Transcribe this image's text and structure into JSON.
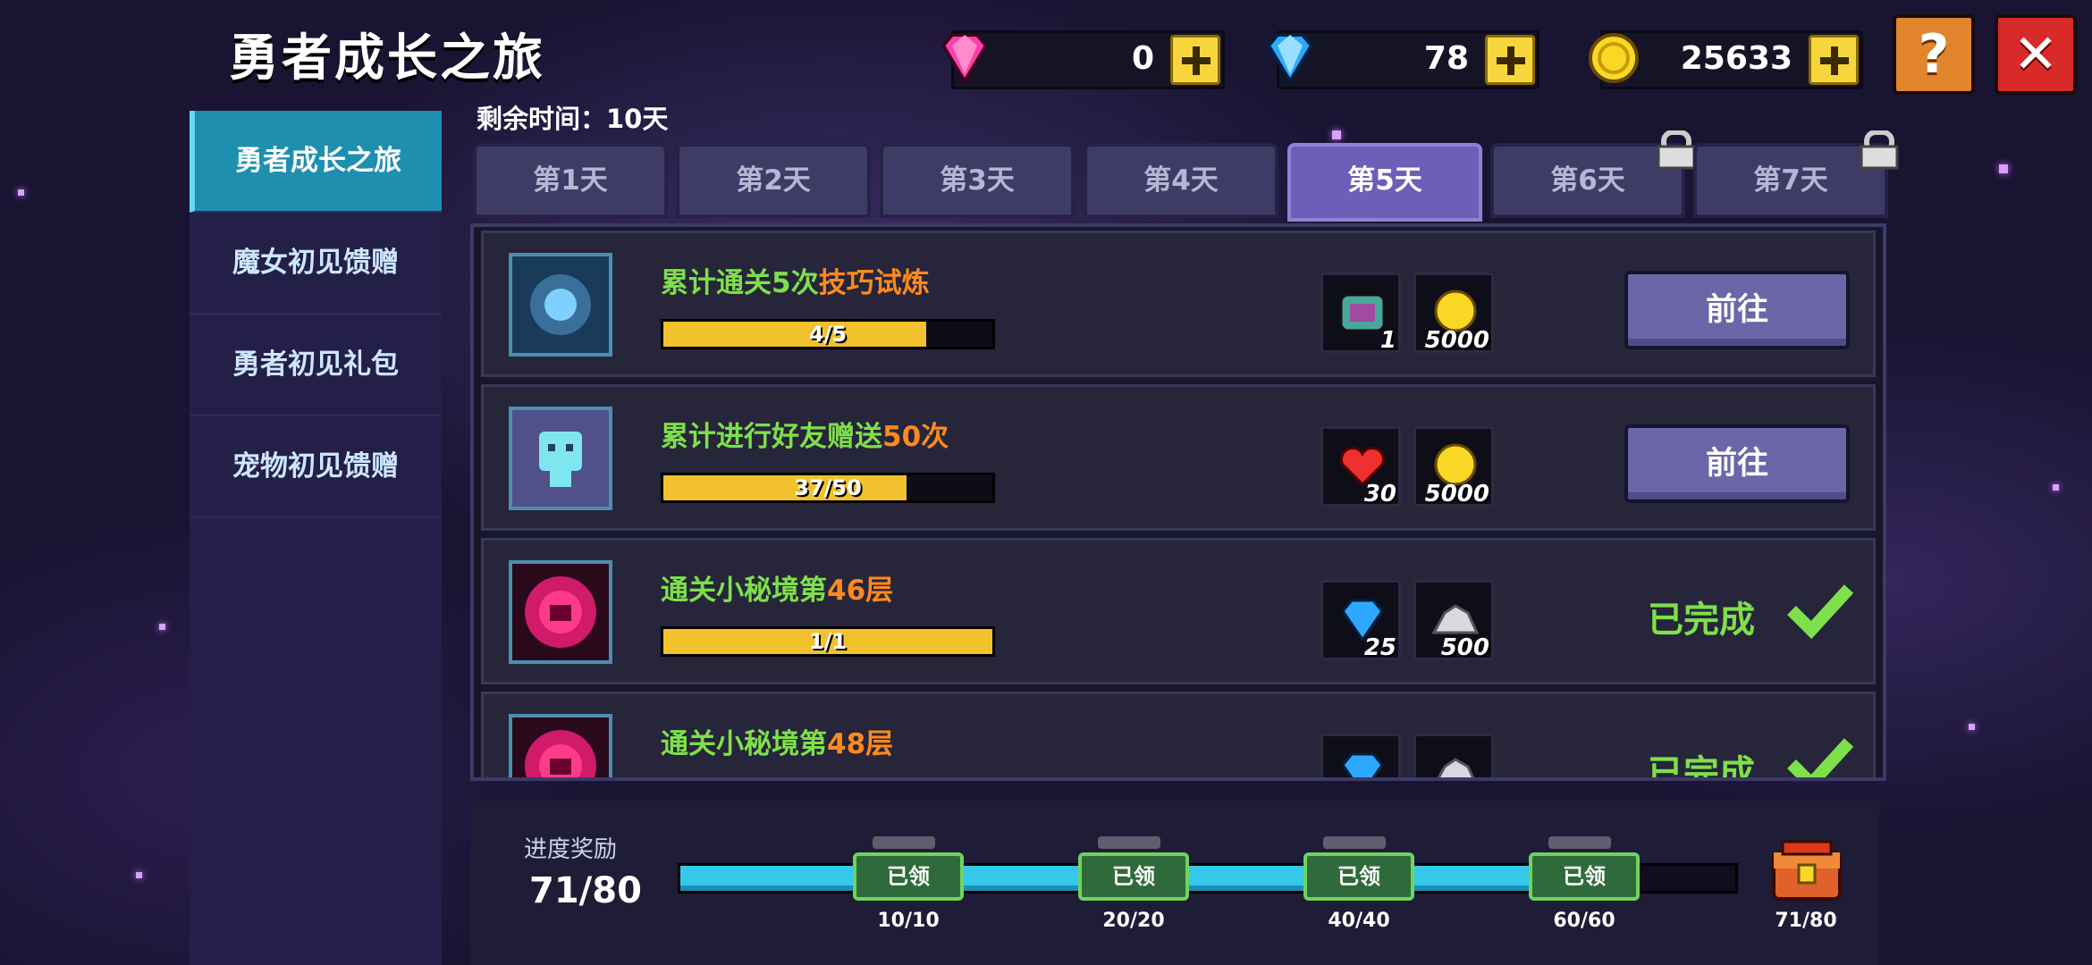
{
  "header": {
    "title": "勇者成长之旅",
    "currencies": [
      {
        "name": "pink-gem",
        "value": "0"
      },
      {
        "name": "blue-gem",
        "value": "78"
      },
      {
        "name": "gold-coin",
        "value": "25633"
      }
    ],
    "help_icon": "?",
    "close_icon": "✕"
  },
  "sidebar": {
    "items": [
      {
        "label": "勇者成长之旅"
      },
      {
        "label": "魔女初见馈赠"
      },
      {
        "label": "勇者初见礼包"
      },
      {
        "label": "宠物初见馈赠"
      }
    ]
  },
  "remaining_time": "剩余时间：10天",
  "tabs": [
    {
      "label": "第1天"
    },
    {
      "label": "第2天"
    },
    {
      "label": "第3天"
    },
    {
      "label": "第4天"
    },
    {
      "label": "第5天"
    },
    {
      "label": "第6天"
    },
    {
      "label": "第7天"
    }
  ],
  "tasks": [
    {
      "title_a": "累计通关5次",
      "title_b": "技巧试炼",
      "title_c": "",
      "progress_text": "4/5",
      "progress": 0.8,
      "rewards": [
        {
          "icon": "chest-item-icon",
          "count": "1"
        },
        {
          "icon": "gold-coin-icon",
          "count": "5000"
        }
      ],
      "action": "前往"
    },
    {
      "title_a": "累计进行好友赠送",
      "title_b": "50次",
      "title_c": "",
      "progress_text": "37/50",
      "progress": 0.74,
      "rewards": [
        {
          "icon": "heart-icon",
          "count": "30"
        },
        {
          "icon": "gold-coin-icon",
          "count": "5000"
        }
      ],
      "action": "前往"
    },
    {
      "title_a": "通关小秘境第",
      "title_b": "46层",
      "title_c": "",
      "progress_text": "1/1",
      "progress": 1.0,
      "rewards": [
        {
          "icon": "blue-gem-icon",
          "count": "25"
        },
        {
          "icon": "ore-icon",
          "count": "500"
        }
      ],
      "status": "已完成"
    },
    {
      "title_a": "通关小秘境第",
      "title_b": "48层",
      "title_c": "",
      "progress_text": "",
      "progress": 1.0,
      "rewards": [
        {
          "icon": "blue-gem-icon",
          "count": ""
        },
        {
          "icon": "ore-icon",
          "count": ""
        }
      ],
      "status": "已完成"
    }
  ],
  "progress_rewards": {
    "label": "进度奖励",
    "value": "71/80",
    "progress": 0.8875,
    "milestones": [
      {
        "state": "已领",
        "label": "10/10"
      },
      {
        "state": "已领",
        "label": "20/20"
      },
      {
        "state": "已领",
        "label": "40/40"
      },
      {
        "state": "已领",
        "label": "60/60"
      }
    ],
    "final_label": "71/80"
  }
}
